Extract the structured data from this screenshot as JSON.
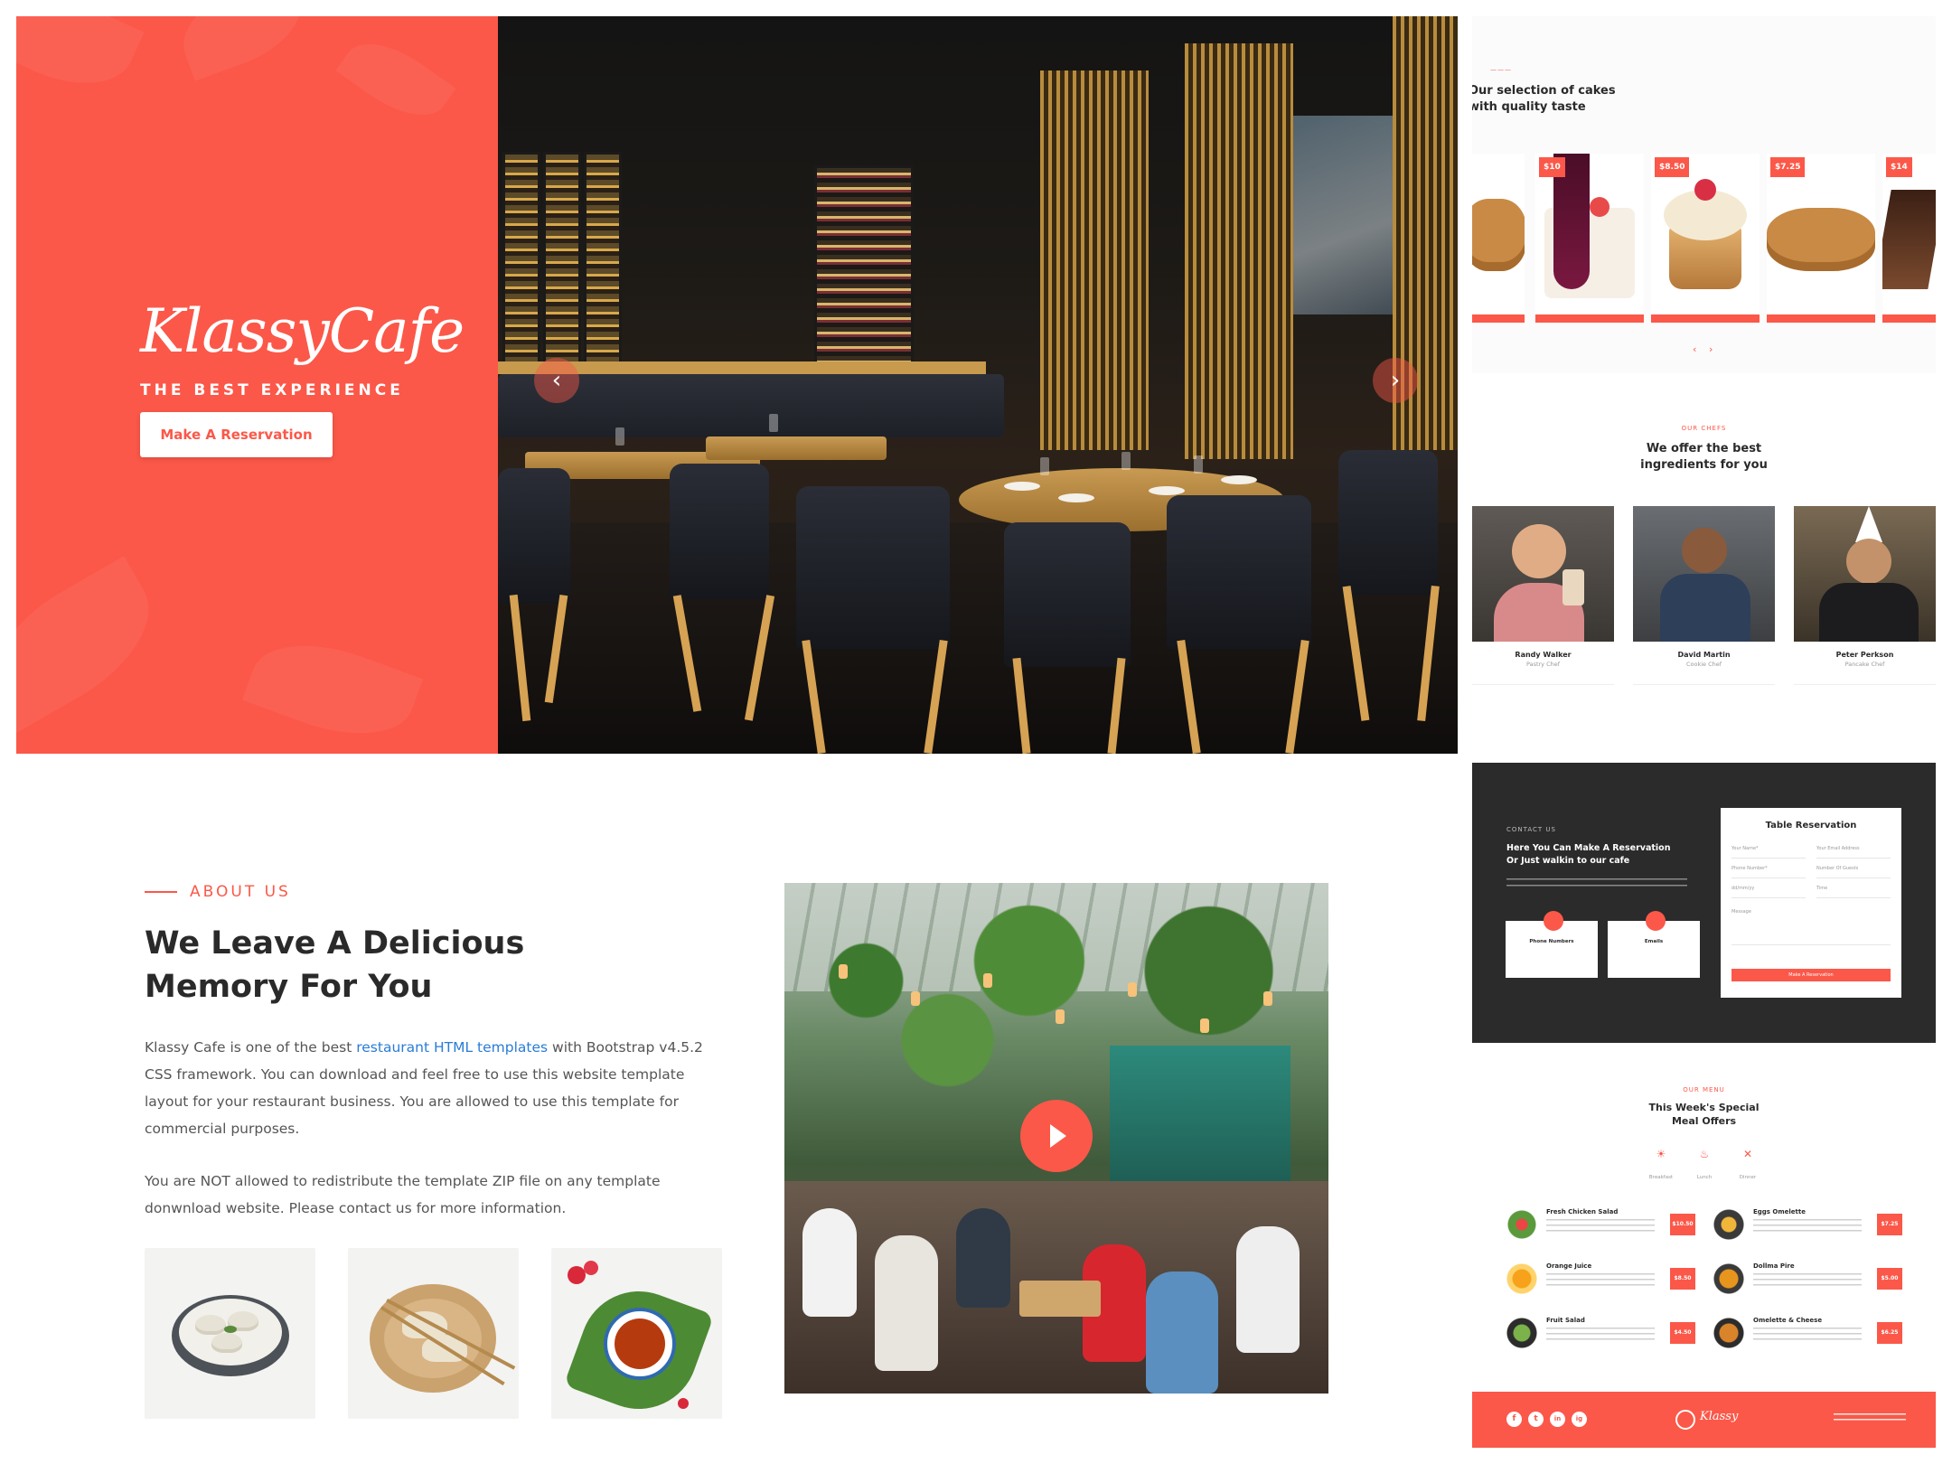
{
  "colors": {
    "accent": "#fb5849",
    "dark": "#2b2b2b",
    "text": "#2a2a2a",
    "link": "#2a7cd7"
  },
  "hero": {
    "logo": "KlassyCafe",
    "tagline": "THE BEST EXPERIENCE",
    "cta": "Make A Reservation",
    "prev_icon": "chevron-left-icon",
    "next_icon": "chevron-right-icon"
  },
  "about": {
    "eyebrow": "ABOUT US",
    "title_line1": "We Leave A Delicious",
    "title_line2": "Memory For You",
    "para1_before": "Klassy Cafe is one of the best ",
    "para1_link": "restaurant HTML templates",
    "para1_after": " with Bootstrap v4.5.2 CSS framework. You can download and feel free to use this website template layout for your restaurant business. You are allowed to use this template for commercial purposes.",
    "para2": "You are NOT allowed to redistribute the template ZIP file on any template donwnload website. Please contact us for more information.",
    "play_icon": "play-icon"
  },
  "menu_preview": {
    "title_line1": "Our selection of cakes",
    "title_line2": "with quality taste",
    "prices": [
      "$10",
      "$8.50",
      "$7.25",
      "$14"
    ],
    "arrows": [
      "‹",
      "›"
    ]
  },
  "chefs_preview": {
    "eyebrow": "OUR CHEFS",
    "title_line1": "We offer the best",
    "title_line2": "ingredients for you",
    "chefs": [
      {
        "name": "Randy Walker",
        "role": "Pastry Chef"
      },
      {
        "name": "David Martin",
        "role": "Cookie Chef"
      },
      {
        "name": "Peter Perkson",
        "role": "Pancake Chef"
      }
    ]
  },
  "reservation_preview": {
    "eyebrow": "CONTACT US",
    "title_line1": "Here You Can Make A Reservation",
    "title_line2": "Or Just walkin to our cafe",
    "phone_label": "Phone Numbers",
    "email_label": "Emails",
    "form_title": "Table Reservation",
    "fields": [
      "Your Name*",
      "Your Email Address",
      "Phone Number*",
      "Number Of Guests",
      "dd/mm/yy",
      "Time",
      "Message"
    ],
    "submit": "Make A Reservation"
  },
  "offers_preview": {
    "eyebrow": "OUR MENU",
    "title_line1": "This Week's Special",
    "title_line2": "Meal Offers",
    "tabs": [
      "Breakfast",
      "Lunch",
      "Dinner"
    ],
    "items": [
      {
        "name": "Fresh Chicken Salad",
        "price": "$10.50"
      },
      {
        "name": "Eggs Omelette",
        "price": "$7.25"
      },
      {
        "name": "Orange Juice",
        "price": "$8.50"
      },
      {
        "name": "Dollma Pire",
        "price": "$5.00"
      },
      {
        "name": "Fruit Salad",
        "price": "$4.50"
      },
      {
        "name": "Omelette & Cheese",
        "price": "$6.25"
      }
    ]
  },
  "footer_preview": {
    "social": [
      "f",
      "t",
      "in",
      "ig"
    ],
    "logo": "Klassy"
  }
}
